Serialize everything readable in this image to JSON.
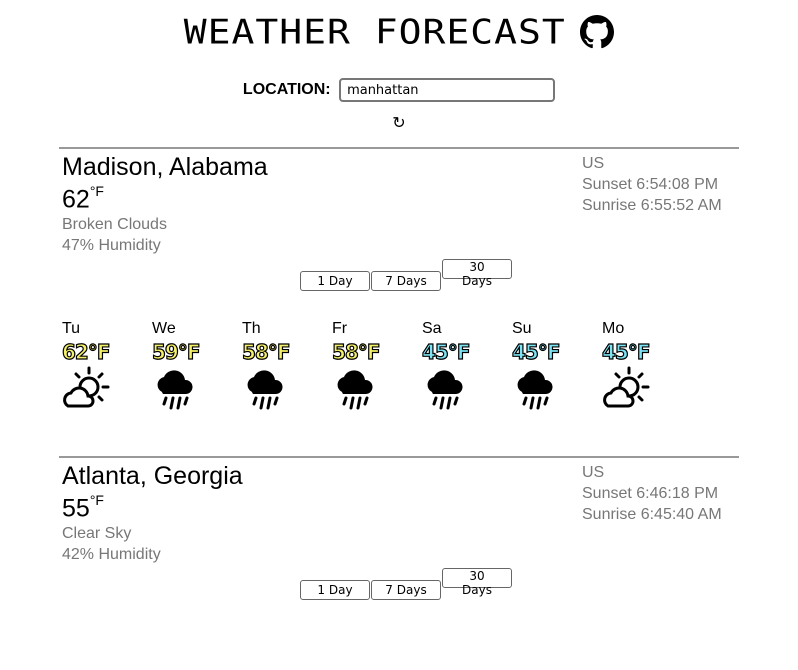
{
  "header": {
    "title": "WEATHER FORECAST"
  },
  "location": {
    "label": "LOCATION:",
    "value": "manhattan"
  },
  "refresh_glyph": "↻",
  "cities": [
    {
      "name": "Madison, Alabama",
      "temp": "62",
      "unit": "°F",
      "condition": "Broken Clouds",
      "humidity": "47% Humidity",
      "country": "US",
      "sunset": "Sunset 6:54:08 PM",
      "sunrise": "Sunrise 6:55:52 AM",
      "buttons": [
        "1 Day",
        "7 Days",
        "30 Days"
      ]
    },
    {
      "name": "Atlanta, Georgia",
      "temp": "55",
      "unit": "°F",
      "condition": "Clear Sky",
      "humidity": "42% Humidity",
      "country": "US",
      "sunset": "Sunset 6:46:18 PM",
      "sunrise": "Sunrise 6:45:40 AM",
      "buttons": [
        "1 Day",
        "7 Days",
        "30 Days"
      ]
    }
  ],
  "forecast": [
    {
      "day": "Tu",
      "temp": "62°F",
      "color": "#f5f06a",
      "icon": "partly-cloudy-sun-icon"
    },
    {
      "day": "We",
      "temp": "59°F",
      "color": "#f5f06a",
      "icon": "rain-icon"
    },
    {
      "day": "Th",
      "temp": "58°F",
      "color": "#f5f06a",
      "icon": "rain-icon"
    },
    {
      "day": "Fr",
      "temp": "58°F",
      "color": "#f5f06a",
      "icon": "rain-icon"
    },
    {
      "day": "Sa",
      "temp": "45°F",
      "color": "#7ee3f2",
      "icon": "rain-icon"
    },
    {
      "day": "Su",
      "temp": "45°F",
      "color": "#7ee3f2",
      "icon": "rain-icon"
    },
    {
      "day": "Mo",
      "temp": "45°F",
      "color": "#7ee3f2",
      "icon": "partly-cloudy-sun-icon"
    }
  ]
}
